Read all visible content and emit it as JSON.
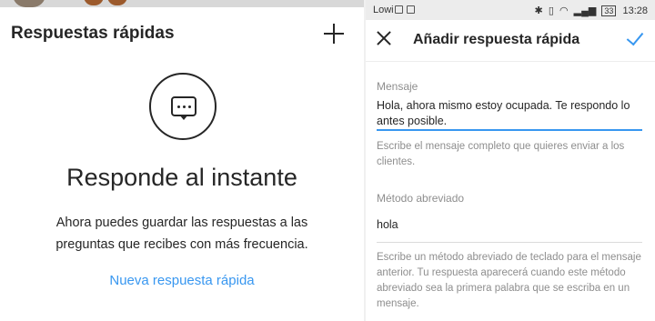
{
  "left": {
    "title": "Respuestas rápidas",
    "hero_title": "Responde al instante",
    "hero_description": "Ahora puedes guardar las respuestas a las preguntas que recibes con más frecuencia.",
    "new_reply_link": "Nueva respuesta rápida",
    "icons": [
      "plus-icon",
      "chat-bubble-icon"
    ]
  },
  "statusbar": {
    "carrier": "Lowi",
    "battery": "33",
    "time": "13:28"
  },
  "right": {
    "title": "Añadir respuesta rápida",
    "message": {
      "label": "Mensaje",
      "value": "Hola, ahora mismo estoy ocupada. Te respondo lo antes posible.",
      "hint": "Escribe el mensaje completo que quieres enviar a los clientes."
    },
    "shortcut": {
      "label": "Método abreviado",
      "value": "hola",
      "hint": "Escribe un método abreviado de teclado para el mensaje anterior. Tu respuesta aparecerá cuando este método abreviado sea la primera palabra que se escriba en un mensaje."
    }
  },
  "colors": {
    "accent": "#3897f0",
    "text": "#262626",
    "muted": "#8e8e8e"
  }
}
